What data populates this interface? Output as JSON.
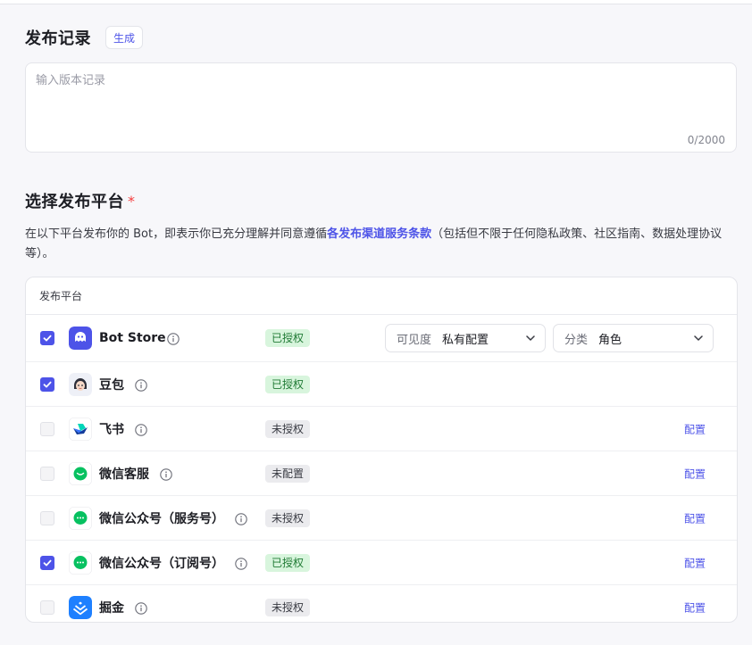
{
  "release": {
    "title": "发布记录",
    "generate_label": "生成",
    "placeholder": "输入版本记录",
    "value": "",
    "counter": "0/2000"
  },
  "platforms_section": {
    "title": "选择发布平台",
    "required_mark": "*",
    "desc_before": "在以下平台发布你的 Bot，即表示你已充分理解并同意遵循",
    "terms_link": "各发布渠道服务条款",
    "desc_after": "（包括但不限于任何隐私政策、社区指南、数据处理协议等）。",
    "table_header": "发布平台"
  },
  "platforms": [
    {
      "name": "Bot Store",
      "checked": true,
      "status": "已授权",
      "status_type": "ok",
      "icon": "bot-store-icon"
    },
    {
      "name": "豆包",
      "checked": true,
      "status": "已授权",
      "status_type": "ok",
      "icon": "doubao-icon"
    },
    {
      "name": "飞书",
      "checked": false,
      "status": "未授权",
      "status_type": "no",
      "action": "配置",
      "icon": "feishu-icon"
    },
    {
      "name": "微信客服",
      "checked": false,
      "status": "未配置",
      "status_type": "no",
      "action": "配置",
      "icon": "wechat-icon"
    },
    {
      "name": "微信公众号（服务号）",
      "checked": false,
      "status": "未授权",
      "status_type": "no",
      "action": "配置",
      "icon": "wechat-icon"
    },
    {
      "name": "微信公众号（订阅号）",
      "checked": true,
      "status": "已授权",
      "status_type": "ok",
      "action": "配置",
      "icon": "wechat-icon"
    },
    {
      "name": "掘金",
      "checked": false,
      "status": "未授权",
      "status_type": "no",
      "action": "配置",
      "icon": "juejin-icon"
    }
  ],
  "bot_store_options": {
    "visibility_label": "可见度",
    "visibility_value": "私有配置",
    "category_label": "分类",
    "category_value": "角色"
  },
  "colors": {
    "accent": "#4d53e8",
    "authorized_bg": "#d8f5dd",
    "authorized_text": "#1f7a34",
    "wechat_green": "#07c160",
    "juejin_blue": "#1e80ff"
  }
}
